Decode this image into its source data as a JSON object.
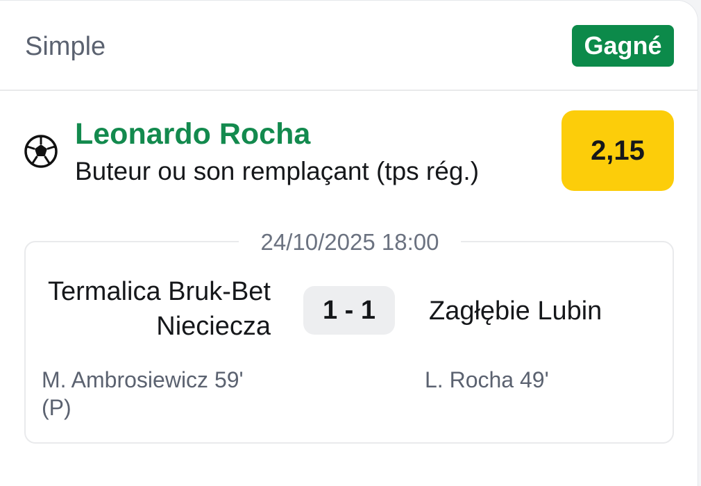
{
  "header": {
    "bet_type": "Simple",
    "status": "Gagné"
  },
  "selection": {
    "icon": "soccer-ball-icon",
    "name": "Leonardo Rocha",
    "market": "Buteur ou son remplaçant (tps rég.)",
    "odds": "2,15"
  },
  "match": {
    "datetime": "24/10/2025 18:00",
    "home_team": "Termalica Bruk-Bet Nieciecza",
    "away_team": "Zagłębie Lubin",
    "score": "1 - 1",
    "home_scorers": "M. Ambrosiewicz 59' (P)",
    "away_scorers": "L. Rocha 49'"
  },
  "colors": {
    "status_green": "#0c8a4a",
    "selection_green": "#138a4e",
    "odds_yellow": "#fccd0a",
    "score_bg": "#edeef0"
  }
}
